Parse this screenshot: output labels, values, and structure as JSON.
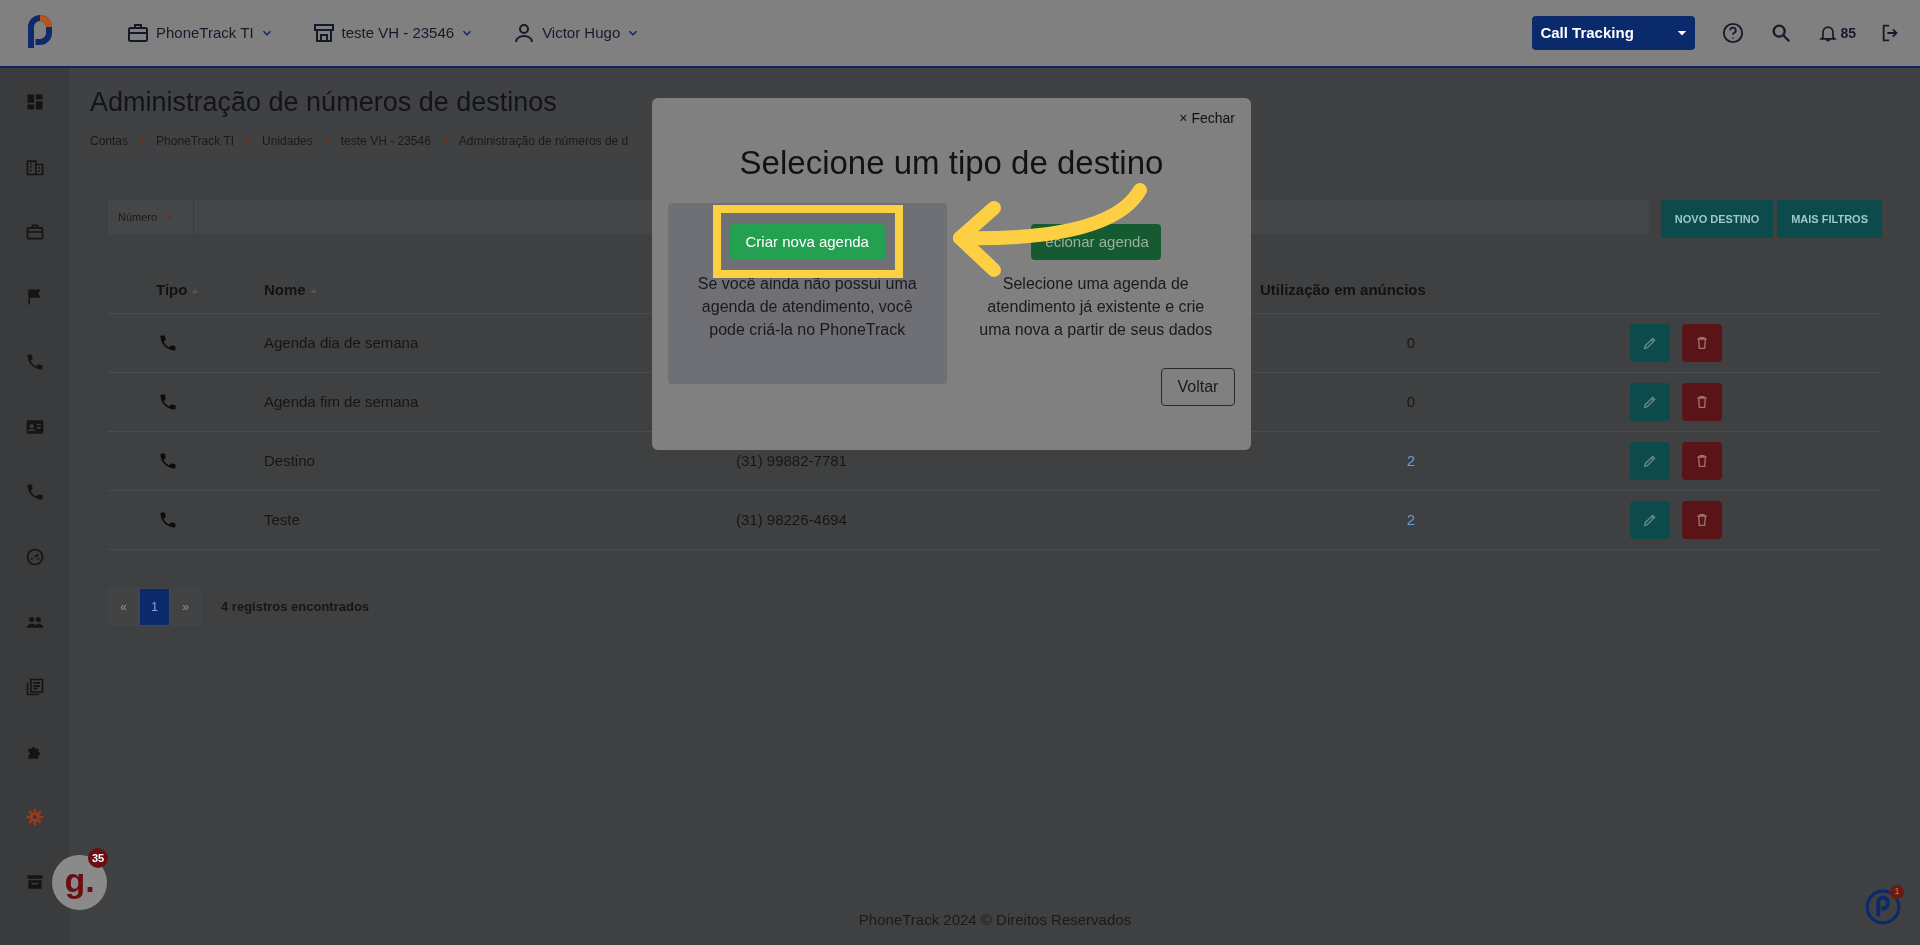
{
  "topbar": {
    "menus": [
      {
        "label": "PhoneTrack TI"
      },
      {
        "label": "teste VH - 23546"
      },
      {
        "label": "Victor Hugo"
      }
    ],
    "product": "Call Tracking",
    "notifications": "85"
  },
  "sidebar": {
    "items": [
      {
        "selected": false
      },
      {
        "selected": false
      },
      {
        "selected": false
      },
      {
        "selected": false
      },
      {
        "selected": false
      },
      {
        "selected": false
      },
      {
        "selected": false
      },
      {
        "selected": false
      },
      {
        "selected": false
      },
      {
        "selected": false
      },
      {
        "selected": false
      },
      {
        "selected": true
      },
      {
        "selected": false
      }
    ]
  },
  "page": {
    "title": "Administração de números de destinos",
    "breadcrumb": [
      "Contas",
      "PhoneTrack TI",
      "Unidades",
      "teste VH - 23546",
      "Administração de números de d"
    ]
  },
  "filter": {
    "field": "Número",
    "buttons": [
      "NOVO DESTINO",
      "MAIS FILTROS"
    ]
  },
  "table": {
    "columns": [
      "Tipo",
      "Nome",
      "Utilização em anúncios"
    ],
    "rows": [
      {
        "name": "Agenda dia de semana",
        "usage": "0",
        "usage_link": false
      },
      {
        "name": "Agenda fim de semana",
        "usage": "0",
        "usage_link": false
      },
      {
        "name": "Destino",
        "number": "(31) 99882-7781",
        "usage": "2",
        "usage_link": true
      },
      {
        "name": "Teste",
        "number": "(31) 98226-4694",
        "usage": "2",
        "usage_link": true
      }
    ]
  },
  "pagination": {
    "pages": [
      {
        "label": "«",
        "selected": false
      },
      {
        "label": "1",
        "selected": true
      },
      {
        "label": "»",
        "selected": false
      }
    ],
    "summary": "4 registros encontrados"
  },
  "footer": "PhoneTrack 2024 © Direitos Reservados",
  "modal": {
    "close": "× Fechar",
    "title": "Selecione um tipo de destino",
    "options": [
      {
        "button": "Criar nova agenda",
        "text": "Se você ainda não possui uma agenda de atendimento, você pode criá-la no PhoneTrack",
        "highlighted": true
      },
      {
        "button": "ecionar agenda",
        "text": "Selecione uma agenda de atendimento já existente e crie uma nova a partir de seus dados",
        "highlighted": false
      }
    ],
    "back": "Voltar"
  },
  "widget": {
    "letter": "g.",
    "badge": "35"
  },
  "corner_badge": "1"
}
